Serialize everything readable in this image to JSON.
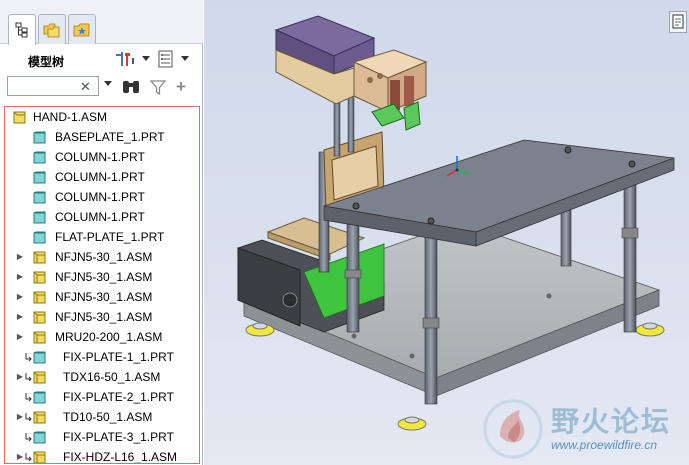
{
  "model_tree": {
    "title": "模型树",
    "search": {
      "value": "",
      "placeholder": ""
    },
    "items": [
      {
        "label": "HAND-1.ASM",
        "type": "asm-root",
        "expandable": false
      },
      {
        "label": "BASEPLATE_1.PRT",
        "type": "part",
        "expandable": false
      },
      {
        "label": "COLUMN-1.PRT",
        "type": "part",
        "expandable": false
      },
      {
        "label": "COLUMN-1.PRT",
        "type": "part",
        "expandable": false
      },
      {
        "label": "COLUMN-1.PRT",
        "type": "part",
        "expandable": false
      },
      {
        "label": "COLUMN-1.PRT",
        "type": "part",
        "expandable": false
      },
      {
        "label": "FLAT-PLATE_1.PRT",
        "type": "part",
        "expandable": false
      },
      {
        "label": "NFJN5-30_1.ASM",
        "type": "asm",
        "expandable": true
      },
      {
        "label": "NFJN5-30_1.ASM",
        "type": "asm",
        "expandable": true
      },
      {
        "label": "NFJN5-30_1.ASM",
        "type": "asm",
        "expandable": true
      },
      {
        "label": "NFJN5-30_1.ASM",
        "type": "asm",
        "expandable": true
      },
      {
        "label": "MRU20-200_1.ASM",
        "type": "asm",
        "expandable": true
      },
      {
        "label": "FIX-PLATE-1_1.PRT",
        "type": "part-linked",
        "expandable": false
      },
      {
        "label": "TDX16-50_1.ASM",
        "type": "asm-linked",
        "expandable": true
      },
      {
        "label": "FIX-PLATE-2_1.PRT",
        "type": "part-linked",
        "expandable": false
      },
      {
        "label": "TD10-50_1.ASM",
        "type": "asm-linked",
        "expandable": true
      },
      {
        "label": "FIX-PLATE-3_1.PRT",
        "type": "part-linked",
        "expandable": false
      },
      {
        "label": "FIX-HDZ-L16_1.ASM",
        "type": "asm-linked",
        "expandable": true
      }
    ]
  },
  "watermark": {
    "text": "野火论坛",
    "url": "www.proewildfire.cn"
  },
  "colors": {
    "selection_border": "#e06a6a",
    "part_icon": "#7fd6d6",
    "asm_icon": "#f2dc5a",
    "table_top": "#7a828e",
    "purple_block": "#7a6a9e",
    "green_block": "#3fc43f"
  }
}
